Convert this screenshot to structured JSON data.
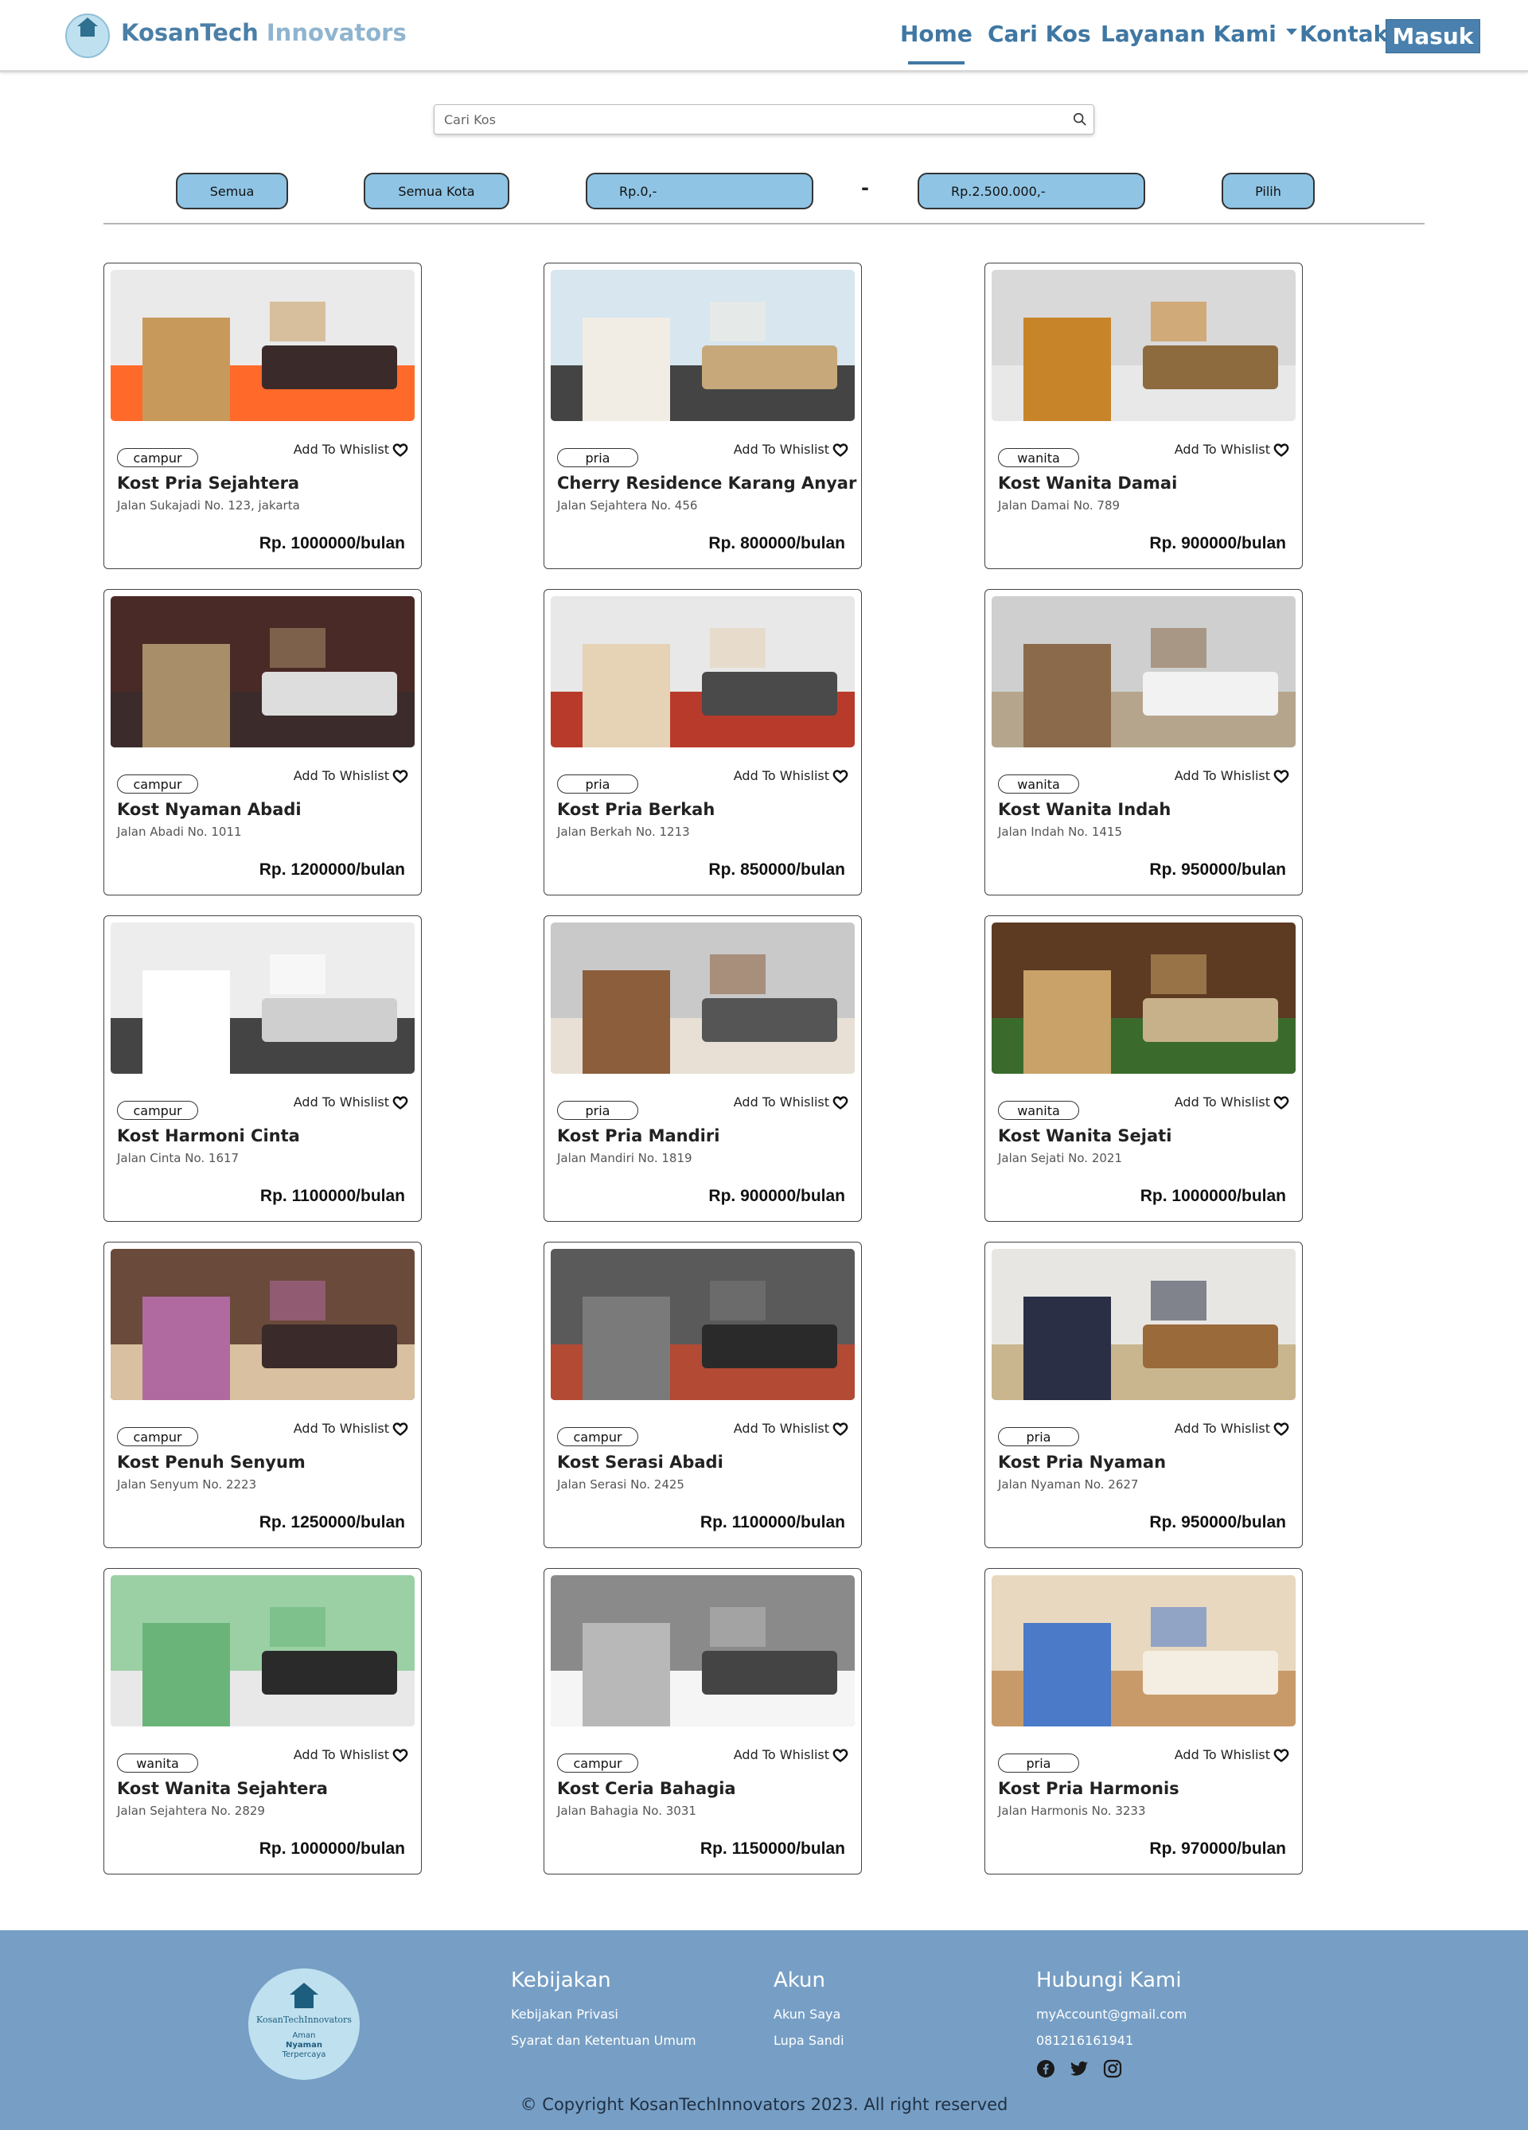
{
  "header": {
    "brand_main": "KosanTech",
    "brand_light": " Innovators",
    "nav": {
      "home": "Home",
      "cari_kos": "Cari Kos",
      "layanan": "Layanan Kami",
      "kontak": "Kontak"
    },
    "login": "Masuk"
  },
  "search": {
    "placeholder": "Cari Kos"
  },
  "filters": {
    "type": "Semua",
    "city": "Semua Kota",
    "price_min": "Rp.0,-",
    "separator": "-",
    "price_max": "Rp.2.500.000,-",
    "submit": "Pilih"
  },
  "wishlist_label": "Add To Whislist",
  "listings": [
    {
      "tag": "campur",
      "name": "Kost Pria Sejahtera",
      "address": "Jalan Sukajadi No. 123, jakarta",
      "price": "Rp. 1000000/bulan"
    },
    {
      "tag": "pria",
      "name": "Cherry Residence Karang Anyar",
      "address": "Jalan Sejahtera No. 456",
      "price": "Rp. 800000/bulan"
    },
    {
      "tag": "wanita",
      "name": "Kost Wanita Damai",
      "address": "Jalan Damai No. 789",
      "price": "Rp. 900000/bulan"
    },
    {
      "tag": "campur",
      "name": "Kost Nyaman Abadi",
      "address": "Jalan Abadi No. 1011",
      "price": "Rp. 1200000/bulan"
    },
    {
      "tag": "pria",
      "name": "Kost Pria Berkah",
      "address": "Jalan Berkah No. 1213",
      "price": "Rp. 850000/bulan"
    },
    {
      "tag": "wanita",
      "name": "Kost Wanita Indah",
      "address": "Jalan Indah No. 1415",
      "price": "Rp. 950000/bulan"
    },
    {
      "tag": "campur",
      "name": "Kost Harmoni Cinta",
      "address": "Jalan Cinta No. 1617",
      "price": "Rp. 1100000/bulan"
    },
    {
      "tag": "pria",
      "name": "Kost Pria Mandiri",
      "address": "Jalan Mandiri No. 1819",
      "price": "Rp. 900000/bulan"
    },
    {
      "tag": "wanita",
      "name": "Kost Wanita Sejati",
      "address": "Jalan Sejati No. 2021",
      "price": "Rp. 1000000/bulan"
    },
    {
      "tag": "campur",
      "name": "Kost Penuh Senyum",
      "address": "Jalan Senyum No. 2223",
      "price": "Rp. 1250000/bulan"
    },
    {
      "tag": "campur",
      "name": "Kost Serasi Abadi",
      "address": "Jalan Serasi No. 2425",
      "price": "Rp. 1100000/bulan"
    },
    {
      "tag": "pria",
      "name": "Kost Pria Nyaman",
      "address": "Jalan Nyaman No. 2627",
      "price": "Rp. 950000/bulan"
    },
    {
      "tag": "wanita",
      "name": "Kost Wanita Sejahtera",
      "address": "Jalan Sejahtera No. 2829",
      "price": "Rp. 1000000/bulan"
    },
    {
      "tag": "campur",
      "name": "Kost Ceria Bahagia",
      "address": "Jalan Bahagia No. 3031",
      "price": "Rp. 1150000/bulan"
    },
    {
      "tag": "pria",
      "name": "Kost Pria Harmonis",
      "address": "Jalan Harmonis No. 3233",
      "price": "Rp. 970000/bulan"
    }
  ],
  "footer": {
    "logo_text": "KosanTechInnovators",
    "logo_tag1": "Aman",
    "logo_tag2": "Nyaman",
    "logo_tag3": "Terpercaya",
    "kebijakan": {
      "title": "Kebijakan",
      "links": [
        "Kebijakan Privasi",
        "Syarat dan Ketentuan Umum"
      ]
    },
    "akun": {
      "title": "Akun",
      "links": [
        "Akun Saya",
        "Lupa Sandi"
      ]
    },
    "hubungi": {
      "title": "Hubungi Kami",
      "email": "myAccount@gmail.com",
      "phone": "081216161941"
    },
    "social_icons": [
      "facebook-icon",
      "twitter-icon",
      "instagram-icon"
    ],
    "copyright": "© Copyright KosanTechInnovators 2023. All right reserved"
  },
  "colors": {
    "brand": "#4a7fa7",
    "pill": "#8fc4e4",
    "footer": "#779fc5"
  }
}
